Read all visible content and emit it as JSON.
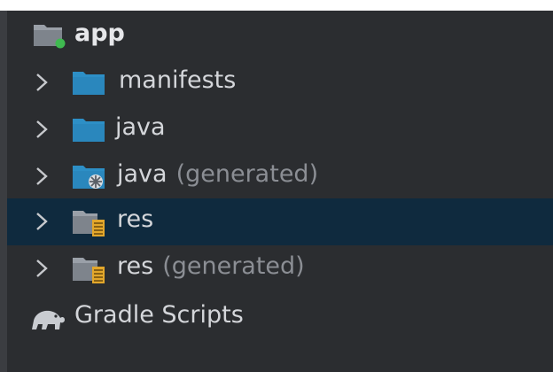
{
  "tree": {
    "module": {
      "name": "app",
      "icon": "module-folder-icon"
    },
    "items": [
      {
        "label": "manifests",
        "suffix": "",
        "icon": "folder-icon"
      },
      {
        "label": "java",
        "suffix": "",
        "icon": "source-folder-icon"
      },
      {
        "label": "java",
        "suffix": "(generated)",
        "icon": "generated-source-folder-icon"
      },
      {
        "label": "res",
        "suffix": "",
        "icon": "resources-folder-icon",
        "selected": true
      },
      {
        "label": "res",
        "suffix": "(generated)",
        "icon": "generated-resources-folder-icon"
      }
    ],
    "gradle": {
      "label": "Gradle Scripts",
      "icon": "gradle-elephant-icon"
    }
  },
  "colors": {
    "background": "#2b2d30",
    "selection": "#0f2a3e",
    "text": "#d4d6da",
    "muted_text": "#8b8e94",
    "folder_blue": "#2d8fc6",
    "module_dot": "#3fb950"
  }
}
